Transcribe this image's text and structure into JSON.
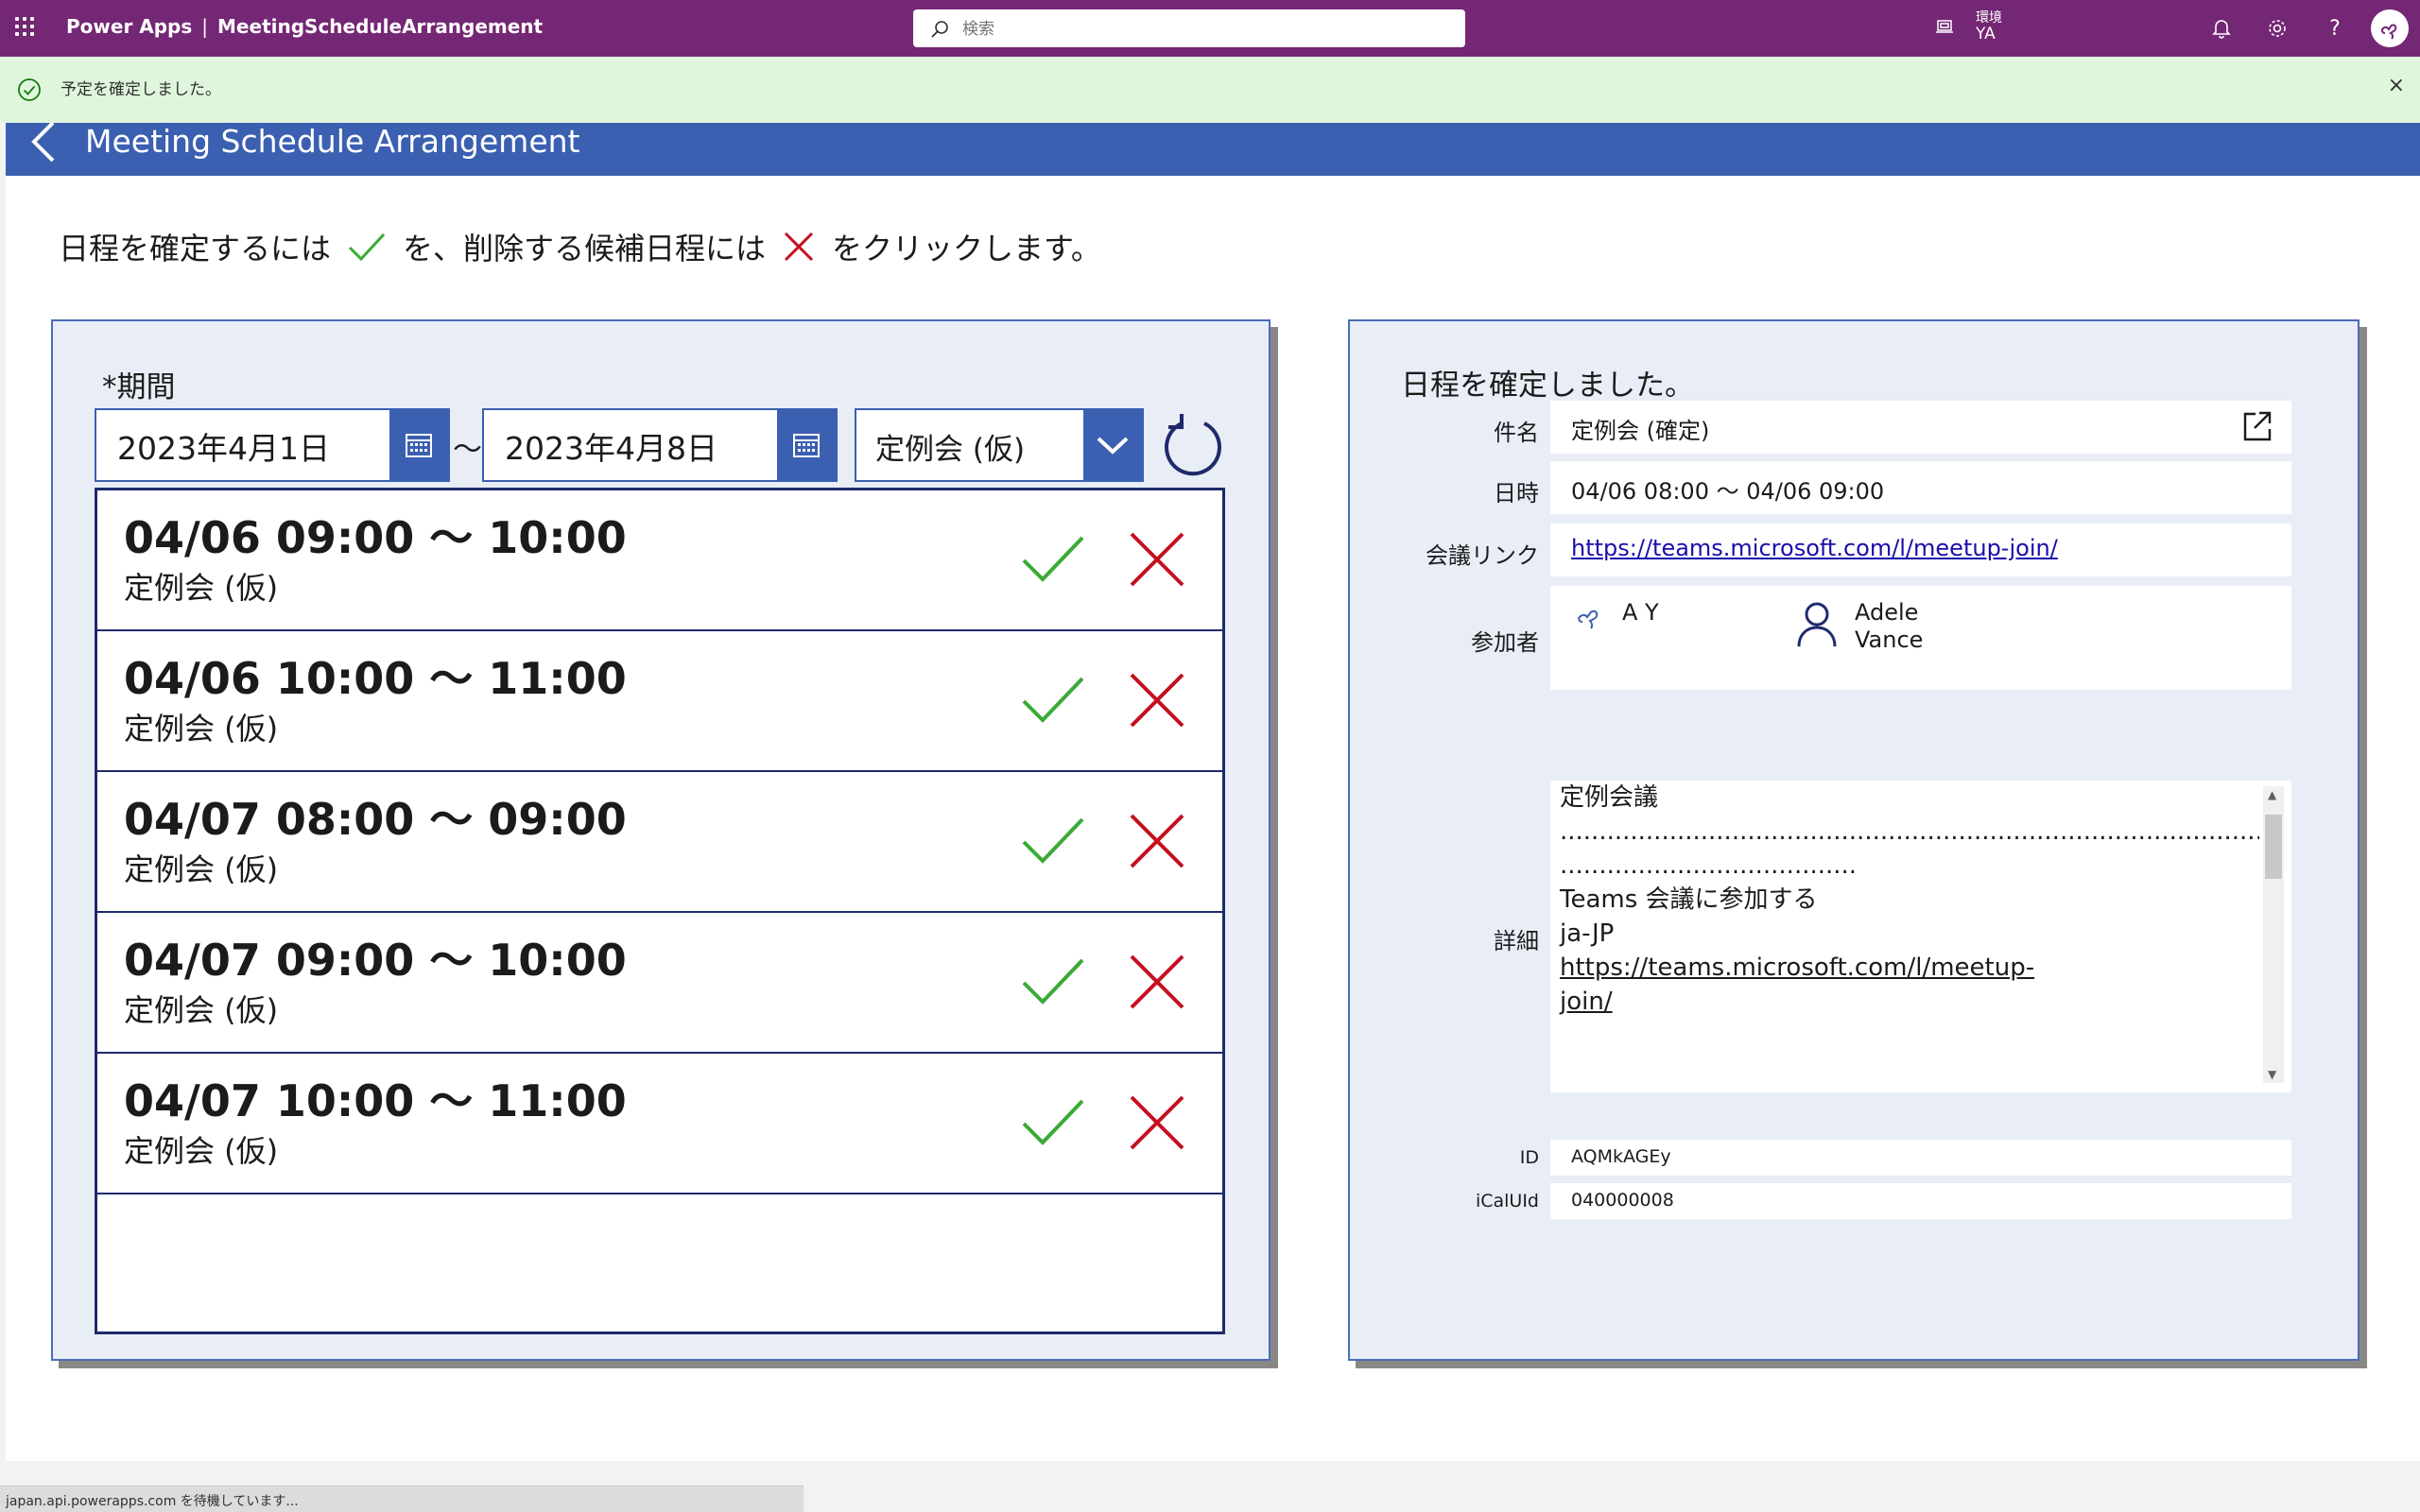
{
  "topbar": {
    "app_name": "Power Apps",
    "separator": "|",
    "app_title": "MeetingScheduleArrangement",
    "search_placeholder": "検索",
    "env_label": "環境",
    "env_value": "YA"
  },
  "notification": {
    "message": "予定を確定しました。",
    "close_label": "×"
  },
  "app_header": {
    "title": "Meeting Schedule Arrangement"
  },
  "instruction": {
    "part1": "日程を確定するには",
    "part2": "を、削除する候補日程には",
    "part3": "をクリックします。"
  },
  "filters": {
    "period_label": "*期間",
    "start_date": "2023年4月1日",
    "tilde": "～",
    "end_date": "2023年4月8日",
    "category_selected": "定例会 (仮)"
  },
  "candidates": [
    {
      "time": "04/06 09:00 ～ 10:00",
      "subject": "定例会 (仮)"
    },
    {
      "time": "04/06 10:00 ～ 11:00",
      "subject": "定例会 (仮)"
    },
    {
      "time": "04/07 08:00 ～ 09:00",
      "subject": "定例会 (仮)"
    },
    {
      "time": "04/07 09:00 ～ 10:00",
      "subject": "定例会 (仮)"
    },
    {
      "time": "04/07 10:00 ～ 11:00",
      "subject": "定例会 (仮)"
    }
  ],
  "confirmed": {
    "title": "日程を確定しました。",
    "subject_label": "件名",
    "subject_value": "定例会 (確定)",
    "datetime_label": "日時",
    "datetime_value": "04/06 08:00 ～ 04/06 09:00",
    "link_label": "会議リンク",
    "link_value": "https://teams.microsoft.com/l/meetup-join/",
    "attendees_label": "参加者",
    "attendees": [
      {
        "name": "A Y"
      },
      {
        "name_line1": "Adele",
        "name_line2": "Vance"
      }
    ],
    "detail_label": "詳細",
    "detail": {
      "line1": "定例会議",
      "dots1": "...............................................................................................",
      "dots2": "......................................",
      "line2": "Teams 会議に参加する",
      "line3": "ja-JP",
      "link_part1": "https://teams.microsoft.com/l/meetup-",
      "link_part2": "join/"
    },
    "id_label": "ID",
    "id_value": "AQMkAGEy",
    "icaluid_label": "iCalUId",
    "icaluid_value": "040000008"
  },
  "statusbar": {
    "text": "japan.api.powerapps.com を待機しています..."
  },
  "colors": {
    "brand": "#742774",
    "header_blue": "#3b5fb1",
    "ok_green": "#3aaa35",
    "ng_red": "#c50f1f",
    "notify_bg": "#dff6dd"
  }
}
